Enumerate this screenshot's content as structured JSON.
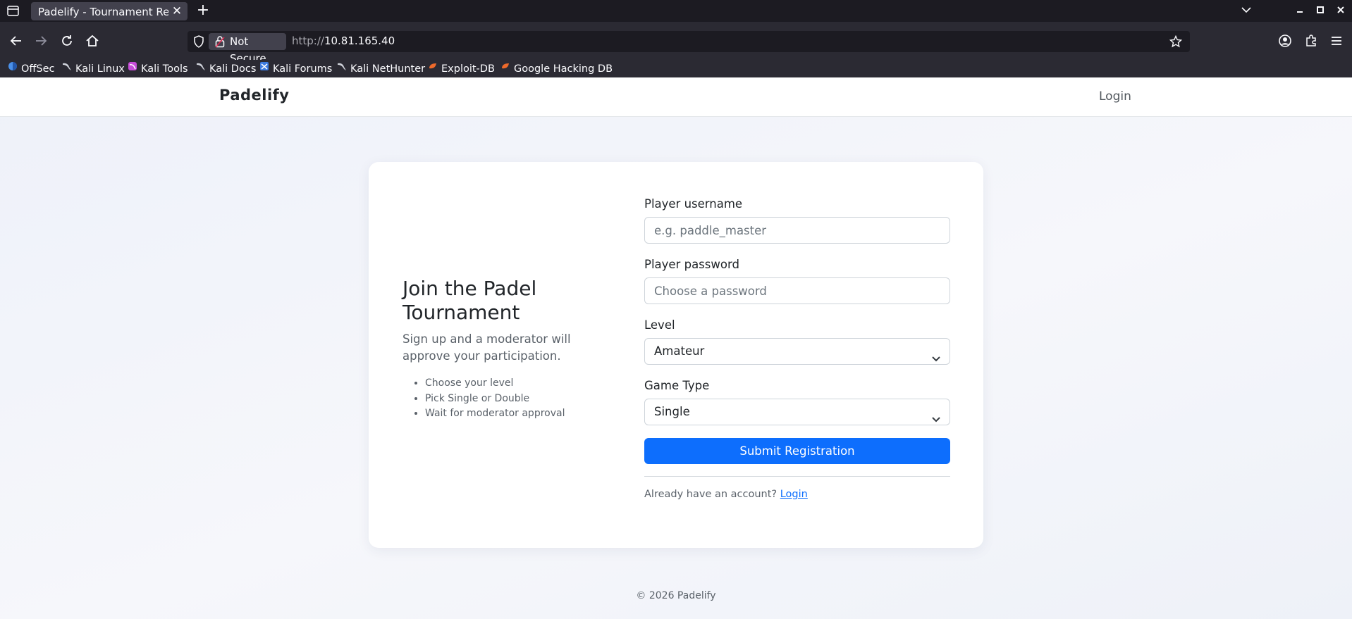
{
  "browser": {
    "tab_title": "Padelify - Tournament Registration",
    "tab_close": "✕",
    "new_tab": "+",
    "security_label": "Not Secure",
    "url_prefix": "http://",
    "url_host": "10.81.165.40",
    "bookmarks": [
      "OffSec",
      "Kali Linux",
      "Kali Tools",
      "Kali Docs",
      "Kali Forums",
      "Kali NetHunter",
      "Exploit-DB",
      "Google Hacking DB"
    ]
  },
  "header": {
    "brand": "Padelify",
    "login": "Login"
  },
  "hero": {
    "title": "Join the Padel Tournament",
    "subtitle": "Sign up and a moderator will approve your participation.",
    "bullets": [
      "Choose your level",
      "Pick Single or Double",
      "Wait for moderator approval"
    ]
  },
  "form": {
    "username_label": "Player username",
    "username_placeholder": "e.g. paddle_master",
    "password_label": "Player password",
    "password_placeholder": "Choose a password",
    "level_label": "Level",
    "level_value": "Amateur",
    "game_type_label": "Game Type",
    "game_type_value": "Single",
    "submit_label": "Submit Registration",
    "already_text": "Already have an account?",
    "login_link": "Login"
  },
  "footer": {
    "copyright": "© 2026 Padelify"
  },
  "colors": {
    "primary": "#0d6efd",
    "chrome_dark": "#1c1b22",
    "chrome_toolbar": "#2b2a33"
  }
}
